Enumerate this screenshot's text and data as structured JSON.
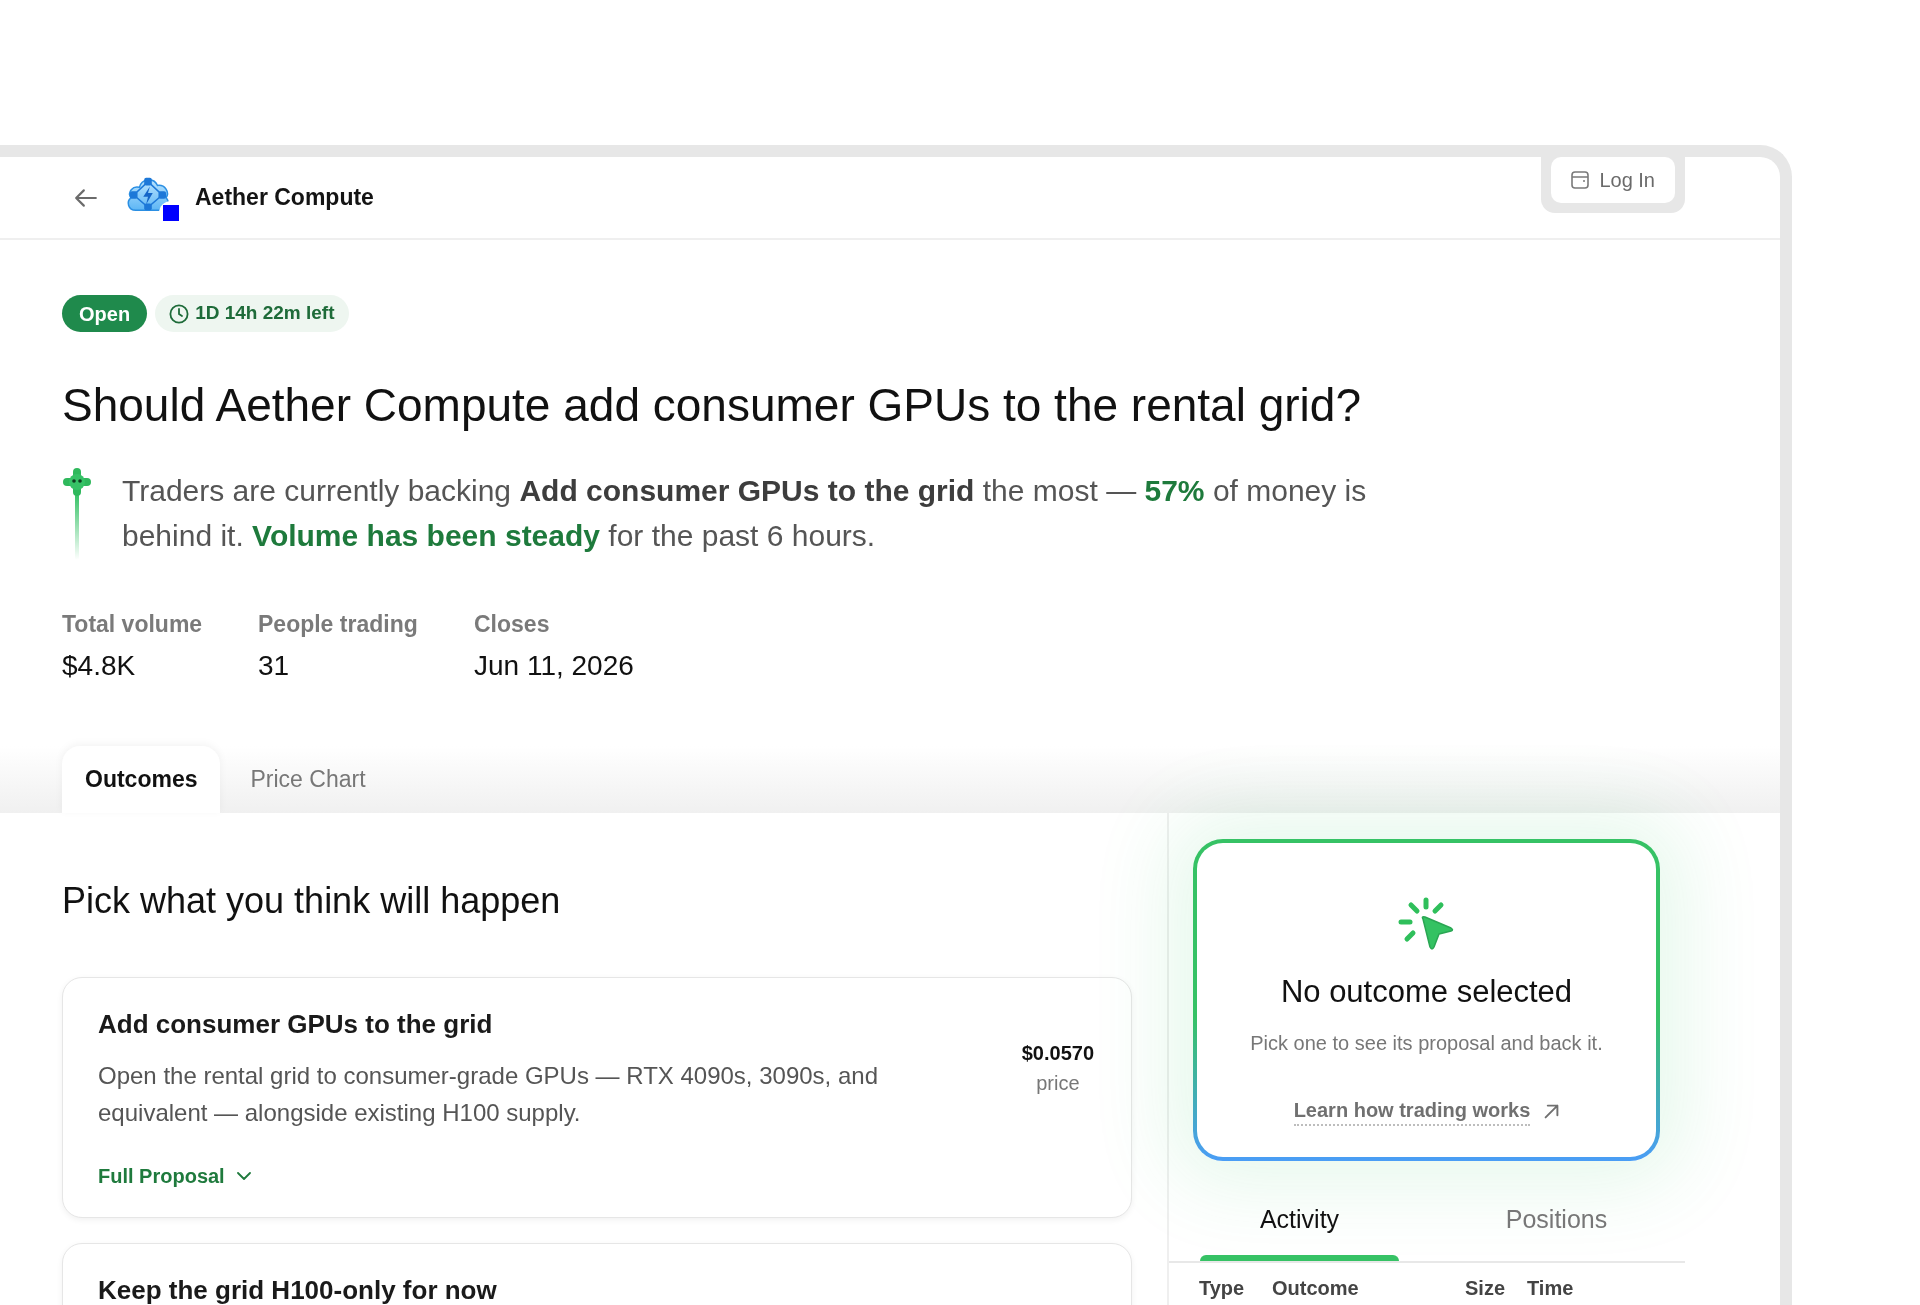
{
  "header": {
    "title": "Aether Compute",
    "login_button": "Log In"
  },
  "market": {
    "status": {
      "label": "Open",
      "kind": "open"
    },
    "time_left": "1D 14h 22m left",
    "title": "Should Aether Compute add consumer GPUs to the rental grid?",
    "summary": [
      {
        "kind": "plain",
        "text": "Traders are currently backing "
      },
      {
        "kind": "strong",
        "text": "Add consumer GPUs to the grid"
      },
      {
        "kind": "plain",
        "text": " the most — "
      },
      {
        "kind": "positive",
        "text": "57%"
      },
      {
        "kind": "plain",
        "text": " of money is behind it. "
      },
      {
        "kind": "positive",
        "text": "Volume has been steady"
      },
      {
        "kind": "plain",
        "text": " for the past 6 hours."
      }
    ],
    "stats": [
      {
        "label": "Total volume",
        "value": "$4.8K"
      },
      {
        "label": "People trading",
        "value": "31"
      },
      {
        "label": "Closes",
        "value": "Jun 11, 2026"
      }
    ]
  },
  "tabs": [
    {
      "label": "Outcomes",
      "selected": true
    },
    {
      "label": "Price Chart",
      "selected": false
    }
  ],
  "outcomes": {
    "heading": "Pick what you think will happen",
    "items": [
      {
        "title": "Add consumer GPUs to the grid",
        "description": "Open the rental grid to consumer-grade GPUs — RTX 4090s, 3090s, and equivalent — alongside existing H100 supply.",
        "price": "$0.0570",
        "price_label": "price",
        "link": "Full Proposal"
      },
      {
        "title": "Keep the grid H100-only for now"
      }
    ]
  },
  "selection_panel": {
    "title": "No outcome selected",
    "text": "Pick one to see its proposal and back it.",
    "link": "Learn how trading works"
  },
  "activity": {
    "tabs": [
      {
        "label": "Activity",
        "selected": true
      },
      {
        "label": "Positions",
        "selected": false
      }
    ],
    "columns": [
      "Type",
      "Outcome",
      "Size",
      "Time"
    ]
  }
}
